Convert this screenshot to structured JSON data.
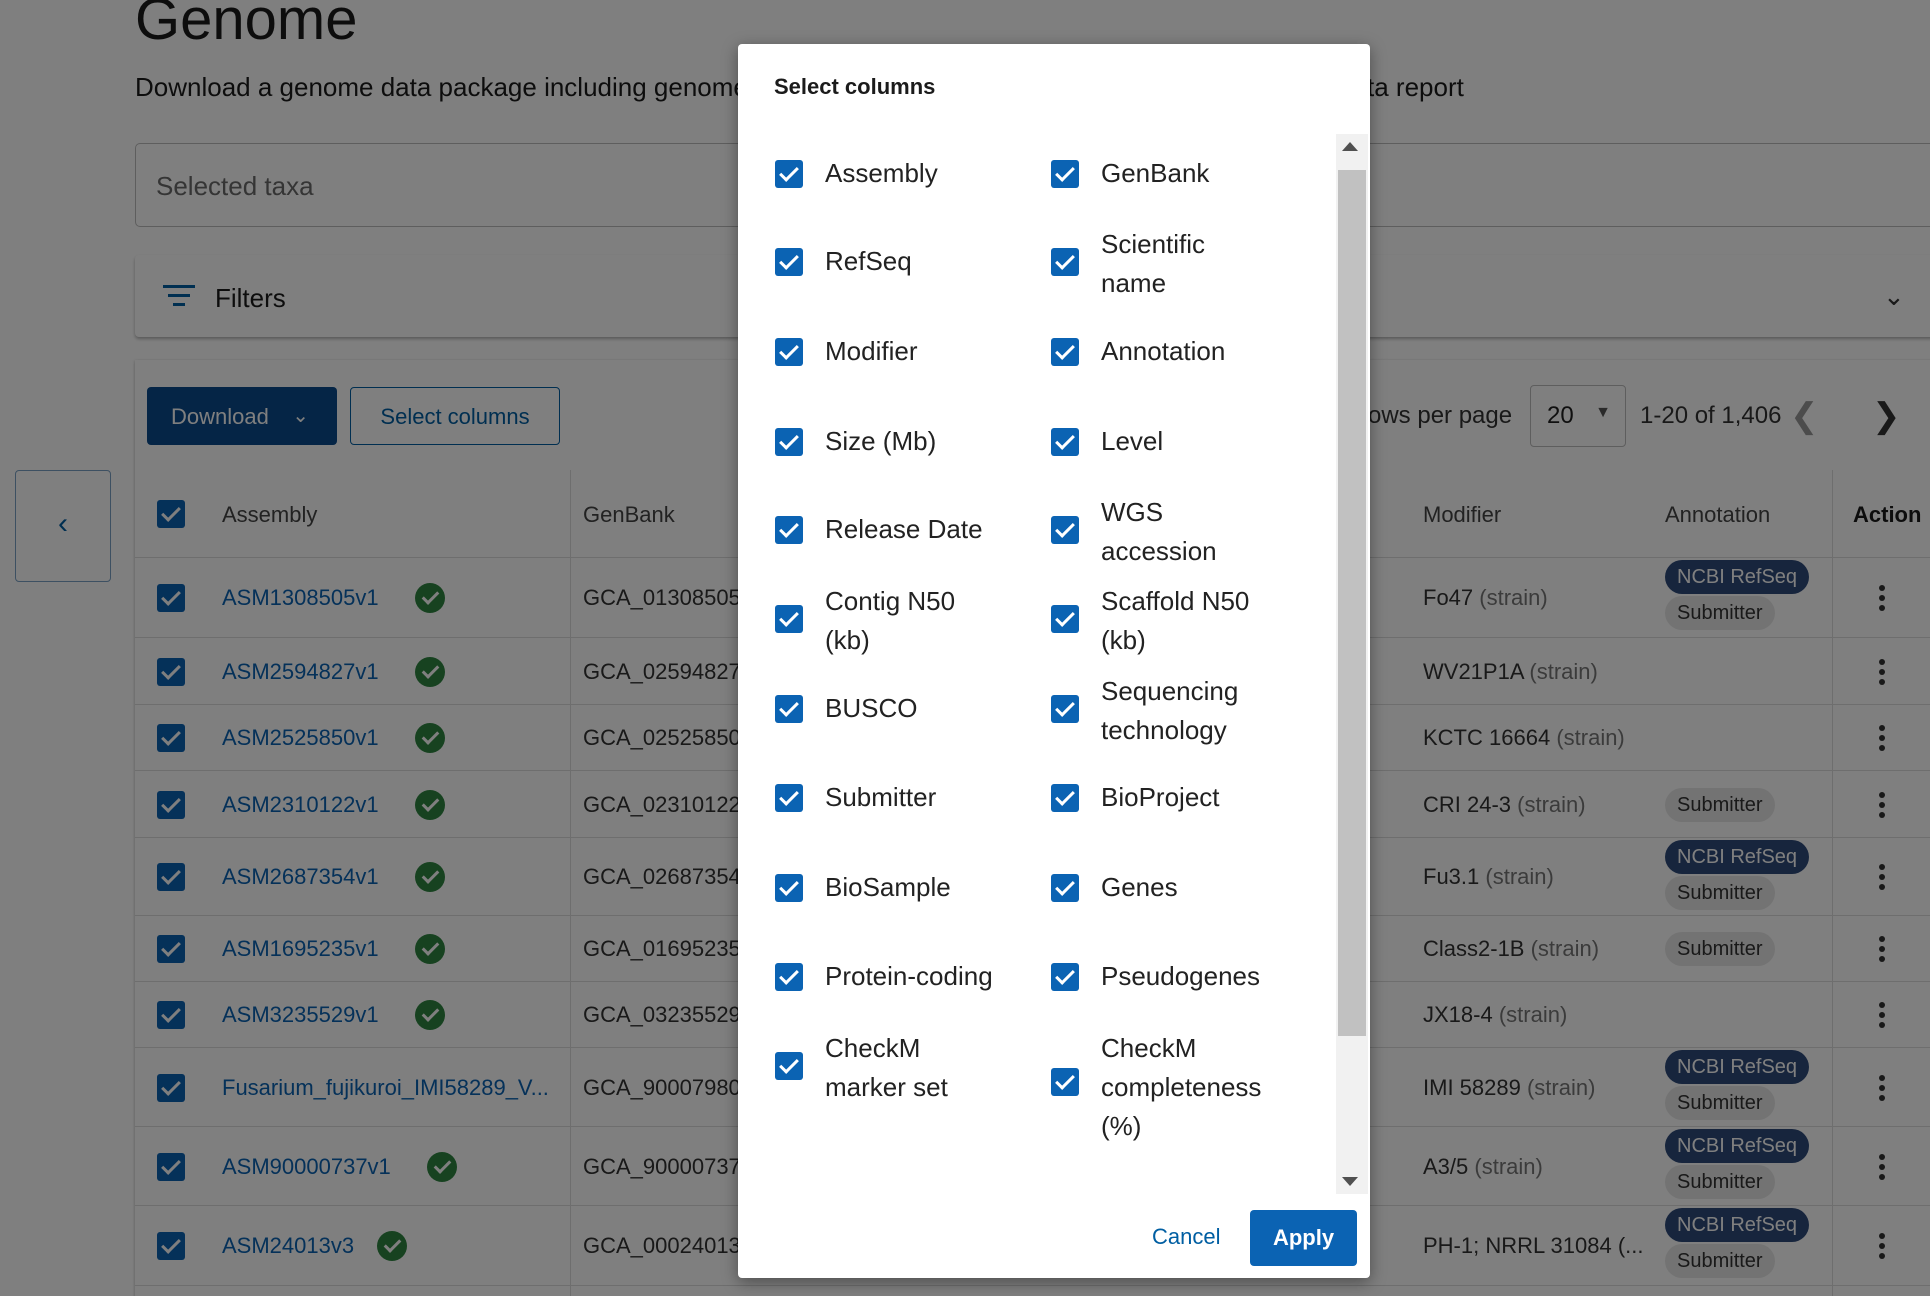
{
  "page": {
    "title": "Genome",
    "subtitle_start": "Download a genome data package including genome",
    "subtitle_end": "ta report"
  },
  "taxa": {
    "placeholder": "Selected taxa"
  },
  "filters": {
    "label": "Filters",
    "icon": "filter-icon"
  },
  "toolbar": {
    "download_label": "Download",
    "select_columns_label": "Select columns",
    "rows_per_page_label": "ows per page",
    "rows_per_page_value": "20",
    "range_text": "1-20 of 1,406"
  },
  "table": {
    "headers": {
      "assembly": "Assembly",
      "genbank": "GenBank",
      "modifier": "Modifier",
      "annotation": "Annotation",
      "action": "Action"
    },
    "rows": [
      {
        "assembly": "ASM1308505v1",
        "genbank": "GCA_01308505",
        "modifier": "Fo47",
        "modifier_type": "(strain)",
        "annotations": [
          "NCBI RefSeq",
          "Submitter"
        ]
      },
      {
        "assembly": "ASM2594827v1",
        "genbank": "GCA_02594827",
        "modifier": "WV21P1A",
        "modifier_type": "(strain)",
        "annotations": []
      },
      {
        "assembly": "ASM2525850v1",
        "genbank": "GCA_02525850",
        "modifier": "KCTC 16664",
        "modifier_type": "(strain)",
        "annotations": []
      },
      {
        "assembly": "ASM2310122v1",
        "genbank": "GCA_02310122",
        "modifier": "CRI 24-3",
        "modifier_type": "(strain)",
        "annotations": [
          "Submitter"
        ]
      },
      {
        "assembly": "ASM2687354v1",
        "genbank": "GCA_02687354",
        "modifier": "Fu3.1",
        "modifier_type": "(strain)",
        "annotations": [
          "NCBI RefSeq",
          "Submitter"
        ]
      },
      {
        "assembly": "ASM1695235v1",
        "genbank": "GCA_01695235",
        "modifier": "Class2-1B",
        "modifier_type": "(strain)",
        "annotations": [
          "Submitter"
        ]
      },
      {
        "assembly": "ASM3235529v1",
        "genbank": "GCA_03235529",
        "modifier": "JX18-4",
        "modifier_type": "(strain)",
        "annotations": []
      },
      {
        "assembly": "Fusarium_fujikuroi_IMI58289_V...",
        "genbank": "GCA_90007980",
        "modifier": "IMI 58289",
        "modifier_type": "(strain)",
        "annotations": [
          "NCBI RefSeq",
          "Submitter"
        ]
      },
      {
        "assembly": "ASM90000737v1",
        "genbank": "GCA_90000737",
        "modifier": "A3/5",
        "modifier_type": "(strain)",
        "annotations": [
          "NCBI RefSeq",
          "Submitter"
        ]
      },
      {
        "assembly": "ASM24013v3",
        "genbank": "GCA_00024013",
        "modifier": "PH-1; NRRL 31084 (...",
        "modifier_type": "",
        "annotations": [
          "NCBI RefSeq",
          "Submitter"
        ]
      }
    ]
  },
  "modal": {
    "title": "Select columns",
    "options_left": [
      [
        "Assembly"
      ],
      [
        "RefSeq"
      ],
      [
        "Modifier"
      ],
      [
        "Size (Mb)"
      ],
      [
        "Release Date"
      ],
      [
        "Contig N50",
        "(kb)"
      ],
      [
        "BUSCO"
      ],
      [
        "Submitter"
      ],
      [
        "BioSample"
      ],
      [
        "Protein-coding"
      ],
      [
        "CheckM",
        "marker set"
      ]
    ],
    "options_right": [
      [
        "GenBank"
      ],
      [
        "Scientific",
        "name"
      ],
      [
        "Annotation"
      ],
      [
        "Level"
      ],
      [
        "WGS",
        "accession"
      ],
      [
        "Scaffold N50",
        "(kb)"
      ],
      [
        "Sequencing",
        "technology"
      ],
      [
        "BioProject"
      ],
      [
        "Genes"
      ],
      [
        "Pseudogenes"
      ],
      [
        "CheckM",
        "completeness",
        "(%)"
      ]
    ],
    "cancel_label": "Cancel",
    "apply_label": "Apply"
  },
  "colors": {
    "primary": "#0b63b3",
    "dark_button": "#0b4b8c",
    "verified_badge": "#2e8540",
    "refseq_pill": "#2f4a7a",
    "overlay": "rgba(0,0,0,0.5)"
  }
}
